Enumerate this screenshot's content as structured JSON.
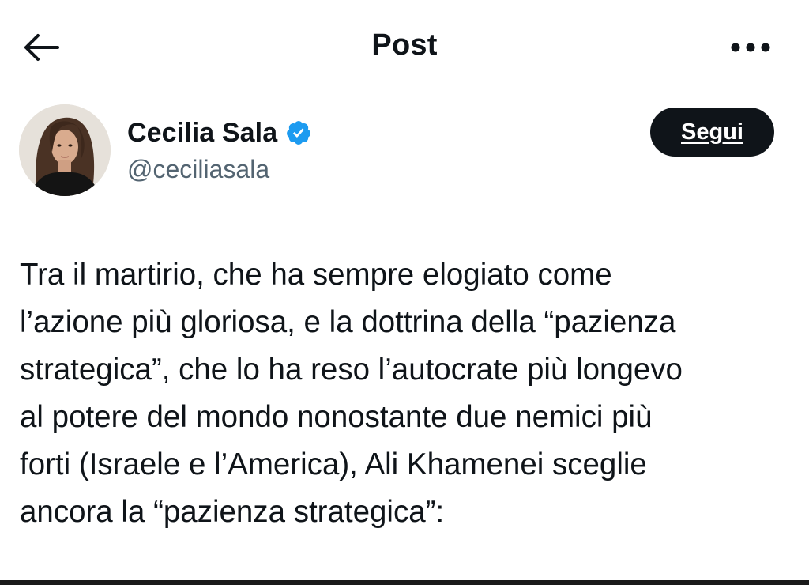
{
  "header": {
    "title": "Post",
    "back_icon": "arrow-left-icon",
    "more_icon": "more-horizontal-icon"
  },
  "author": {
    "display_name": "Cecilia Sala",
    "handle": "@ceciliasala",
    "verified": true,
    "verified_color": "#1d9bf0",
    "follow_label": "Segui"
  },
  "post": {
    "lines": [
      "Tra il martirio, che ha sempre elogiato come",
      "l’azione più gloriosa, e la dottrina della “pazienza",
      "strategica”, che lo ha reso l’autocrate più longevo",
      "al potere del mondo nonostante due nemici più",
      "forti (Israele e l’America), Ali Khamenei sceglie",
      "ancora la “pazienza strategica”:"
    ]
  },
  "colors": {
    "text": "#0f1419",
    "secondary_text": "#536471",
    "button_bg": "#0f1419",
    "button_text": "#ffffff"
  }
}
